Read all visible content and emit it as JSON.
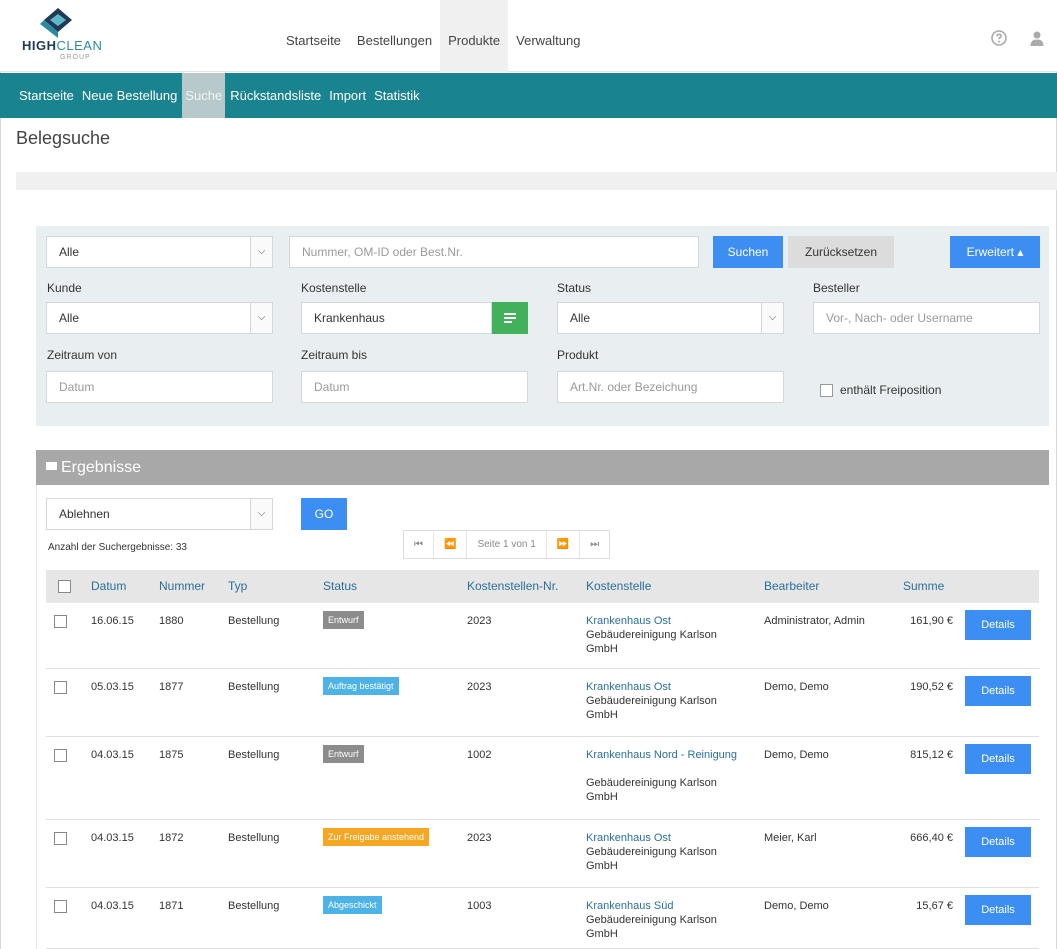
{
  "logo": {
    "brand_bold": "HIGH",
    "brand_light": "CLEAN",
    "brand_sub": "GROUP"
  },
  "top_nav": [
    {
      "label": "Startseite"
    },
    {
      "label": "Bestellungen"
    },
    {
      "label": "Produkte",
      "active": true
    },
    {
      "label": "Verwaltung"
    }
  ],
  "top_icons": [
    "help-icon",
    "user-icon"
  ],
  "sub_nav": [
    {
      "label": "Startseite"
    },
    {
      "label": "Neue Bestellung"
    },
    {
      "label": "Suche",
      "active": true
    },
    {
      "label": "Rückstandsliste"
    },
    {
      "label": "Import"
    },
    {
      "label": "Statistik"
    }
  ],
  "page_title": "Belegsuche",
  "search": {
    "type_select": {
      "value": "Alle"
    },
    "number_input": {
      "placeholder": "Nummer, OM-ID oder Best.Nr."
    },
    "search_button": "Suchen",
    "reset_button": "Zurücksetzen",
    "advanced_button": "Erweitert ▴",
    "kunde": {
      "label": "Kunde",
      "value": "Alle"
    },
    "kostenstelle": {
      "label": "Kostenstelle",
      "value": "Krankenhaus"
    },
    "status": {
      "label": "Status",
      "value": "Alle"
    },
    "besteller": {
      "label": "Besteller",
      "placeholder": "Vor-, Nach- oder Username"
    },
    "zeitraum_von": {
      "label": "Zeitraum von",
      "placeholder": "Datum"
    },
    "zeitraum_bis": {
      "label": "Zeitraum bis",
      "placeholder": "Datum"
    },
    "produkt": {
      "label": "Produkt",
      "placeholder": "Art.Nr. oder Bezeichung"
    },
    "freiposition": {
      "label": "enthält Freiposition",
      "checked": false
    }
  },
  "results": {
    "title": "Ergebnisse",
    "action_select": {
      "value": "Ablehnen"
    },
    "go_button": "GO",
    "count_text": "Anzahl der Suchergebnisse: 33",
    "pager": {
      "first": "⏮",
      "prev": "⏪",
      "info": "Seite 1 von 1",
      "next": "⏩",
      "last": "⏭"
    },
    "columns": [
      "Datum",
      "Nummer",
      "Typ",
      "Status",
      "Kostenstellen-Nr.",
      "Kostenstelle",
      "Bearbeiter",
      "Summe"
    ],
    "details_label": "Details",
    "status_colors": {
      "Entwurf": "#8c8c8c",
      "Auftrag bestätigt": "#4db3e6",
      "Zur Freigabe anstehend": "#f5a623",
      "Abgeschickt": "#4db3e6"
    },
    "rows": [
      {
        "datum": "16.06.15",
        "nummer": "1880",
        "typ": "Bestellung",
        "status": "Entwurf",
        "kst_nr": "2023",
        "kst_link": "Krankenhaus Ost",
        "kst_company": "Gebäudereinigung Karlson GmbH",
        "bearbeiter": "Administrator, Admin",
        "summe": "161,90 €"
      },
      {
        "datum": "05.03.15",
        "nummer": "1877",
        "typ": "Bestellung",
        "status": "Auftrag bestätigt",
        "kst_nr": "2023",
        "kst_link": "Krankenhaus Ost",
        "kst_company": "Gebäudereinigung Karlson GmbH",
        "bearbeiter": "Demo, Demo",
        "summe": "190,52 €"
      },
      {
        "datum": "04.03.15",
        "nummer": "1875",
        "typ": "Bestellung",
        "status": "Entwurf",
        "kst_nr": "1002",
        "kst_link": "Krankenhaus Nord - Reinigung",
        "kst_company": "Gebäudereinigung Karlson GmbH",
        "bearbeiter": "Demo, Demo",
        "summe": "815,12 €"
      },
      {
        "datum": "04.03.15",
        "nummer": "1872",
        "typ": "Bestellung",
        "status": "Zur Freigabe anstehend",
        "kst_nr": "2023",
        "kst_link": "Krankenhaus Ost",
        "kst_company": "Gebäudereinigung Karlson GmbH",
        "bearbeiter": "Meier, Karl",
        "summe": "666,40 €"
      },
      {
        "datum": "04.03.15",
        "nummer": "1871",
        "typ": "Bestellung",
        "status": "Abgeschickt",
        "kst_nr": "1003",
        "kst_link": "Krankenhaus Süd",
        "kst_company": "Gebäudereinigung Karlson GmbH",
        "bearbeiter": "Demo, Demo",
        "summe": "15,67 €"
      }
    ]
  }
}
